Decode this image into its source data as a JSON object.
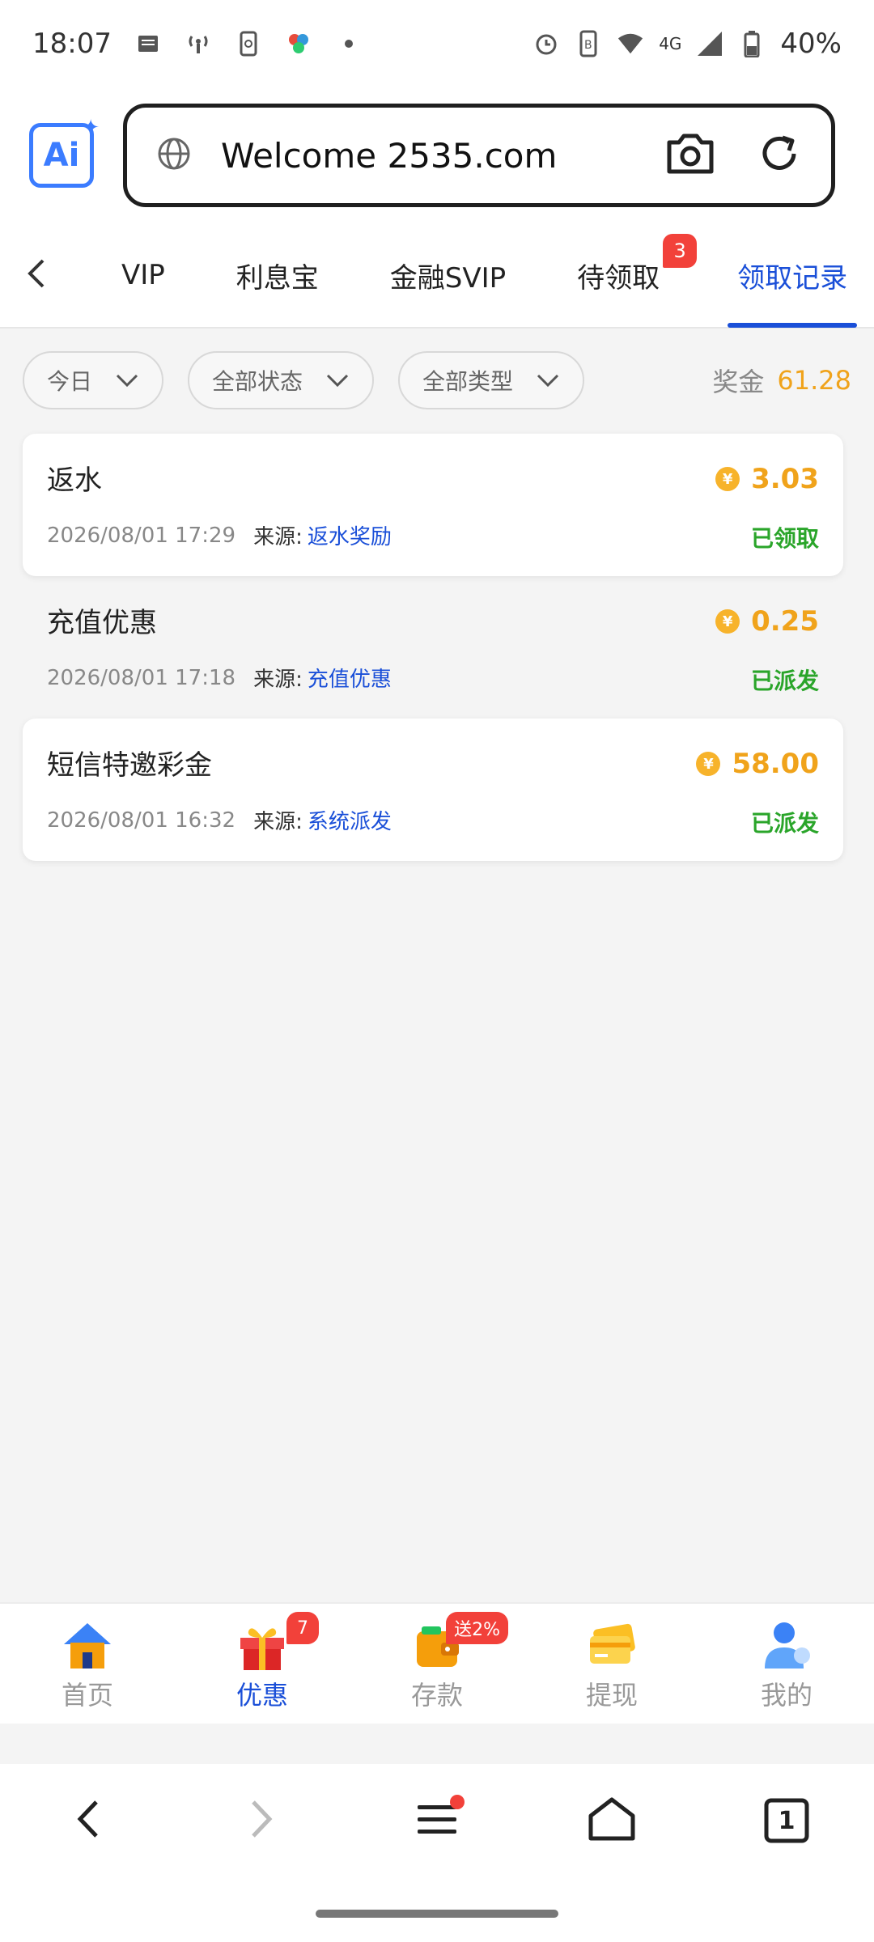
{
  "status_bar": {
    "time": "18:07",
    "network": "4G",
    "battery": "40%",
    "icons_left": [
      "notification-icon",
      "hotspot-icon",
      "phone-sync-icon",
      "app-icon",
      "dot-icon"
    ],
    "icons_right": [
      "alarm-icon",
      "sim-icon",
      "wifi-icon",
      "signal-icon",
      "battery-icon"
    ]
  },
  "browser": {
    "logo_text": "Ai",
    "url": "Welcome 2535.com"
  },
  "tabs": {
    "items": [
      {
        "label": "VIP"
      },
      {
        "label": "利息宝"
      },
      {
        "label": "金融SVIP"
      },
      {
        "label": "待领取",
        "badge": "3"
      },
      {
        "label": "领取记录"
      }
    ],
    "active": "领取记录"
  },
  "filters": {
    "date": "今日",
    "status": "全部状态",
    "type": "全部类型",
    "bonus_label": "奖金",
    "bonus_value": "61.28"
  },
  "records": [
    {
      "title": "返水",
      "amount": "3.03",
      "time": "2026/08/01 17:29",
      "source_label": "来源:",
      "source": "返水奖励",
      "status": "已领取"
    },
    {
      "title": "充值优惠",
      "amount": "0.25",
      "time": "2026/08/01 17:18",
      "source_label": "来源:",
      "source": "充值优惠",
      "status": "已派发"
    },
    {
      "title": "短信特邀彩金",
      "amount": "58.00",
      "time": "2026/08/01 16:32",
      "source_label": "来源:",
      "source": "系统派发",
      "status": "已派发"
    }
  ],
  "bottom_nav": {
    "items": [
      {
        "label": "首页",
        "icon": "home-icon"
      },
      {
        "label": "优惠",
        "icon": "gift-icon",
        "badge": "7"
      },
      {
        "label": "存款",
        "icon": "wallet-icon",
        "badge": "送2%"
      },
      {
        "label": "提现",
        "icon": "card-icon"
      },
      {
        "label": "我的",
        "icon": "user-icon"
      }
    ],
    "active": "优惠"
  },
  "system_nav": {
    "tab_count": "1"
  },
  "colors": {
    "accent": "#1a4fd8",
    "amount": "#f0a31b",
    "status_green": "#2aa52a",
    "badge_red": "#f2413a"
  }
}
